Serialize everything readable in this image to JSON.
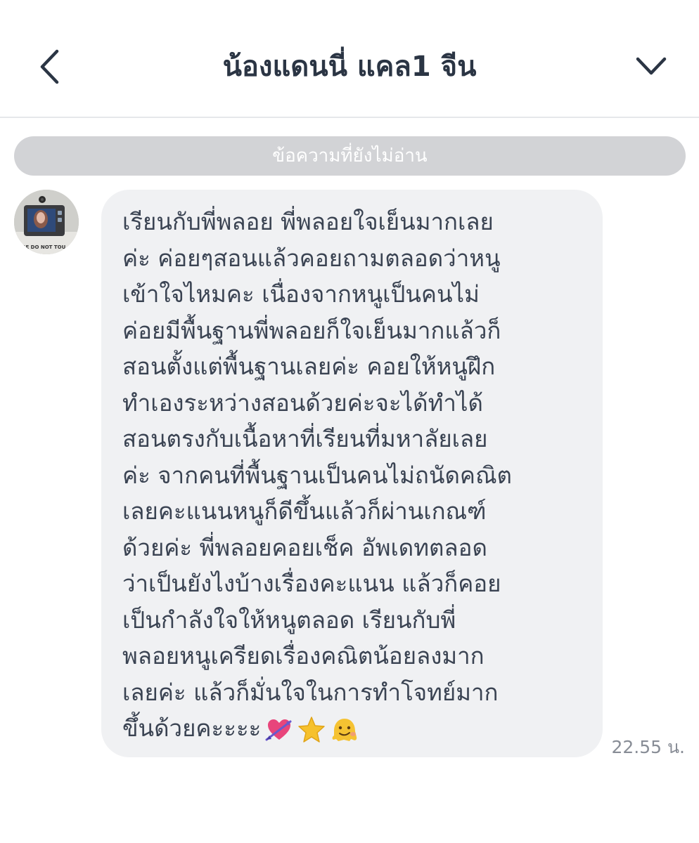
{
  "header": {
    "title": "น้องแดนนี่ แคล1 จีน",
    "back_icon": "chevron-left-icon",
    "menu_icon": "chevron-down-icon"
  },
  "unread_divider": {
    "label": "ข้อความที่ยังไม่อ่าน"
  },
  "message": {
    "lines": [
      "เรียนกับพี่พลอย พี่พลอยใจเย็นมากเลย",
      "ค่ะ ค่อยๆสอนแล้วคอยถามตลอดว่าหนู",
      "เข้าใจไหมคะ เนื่องจากหนูเป็นคนไม่",
      "ค่อยมีพื้นฐานพี่พลอยก็ใจเย็นมากแล้วก็",
      "สอนตั้งแต่พื้นฐานเลยค่ะ คอยให้หนูฝึก",
      "ทำเองระหว่างสอนด้วยค่ะจะได้ทำได้",
      "สอนตรงกับเนื้อหาที่เรียนที่มหาลัยเลย",
      "ค่ะ จากคนที่พื้นฐานเป็นคนไม่ถนัดคณิต",
      "เลยคะแนนหนูก็ดีขึ้นแล้วก็ผ่านเกณฑ์",
      "ด้วยค่ะ พี่พลอยคอยเช็ค อัพเดทตลอด",
      "ว่าเป็นยังไงบ้างเรื่องคะแนน แล้วก็คอย",
      "เป็นกำลังใจให้หนูตลอด เรียนกับพี่",
      "พลอยหนูเครียดเรื่องคณิตน้อยลงมาก",
      "เลยค่ะ แล้วก็มั่นใจในการทำโจทย์มาก",
      "ขึ้นด้วยคะะะะ"
    ],
    "emojis": [
      "heart-with-arrow-icon",
      "star-icon",
      "melting-face-icon"
    ],
    "time": "22.55 น."
  },
  "avatar": {
    "icon": "avatar-photo",
    "sticker_text": "ASE DO NOT TOU"
  },
  "colors": {
    "bubble": "#f0f1f3",
    "divider": "#d2d3d6",
    "text": "#3a4352",
    "heart": "#e8457b",
    "star": "#f6c12c",
    "melting_face": "#f5c232"
  }
}
